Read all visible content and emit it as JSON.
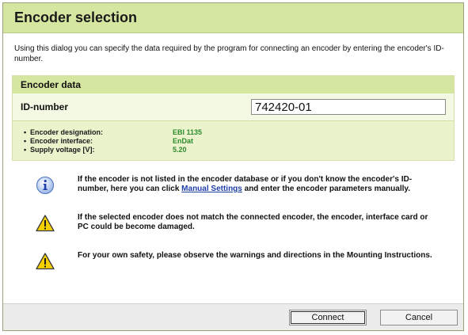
{
  "dialog": {
    "title": "Encoder selection",
    "intro": "Using this dialog you can specify the data required by the program for connecting an encoder by entering the encoder's ID-number."
  },
  "encoder_data": {
    "header": "Encoder data",
    "id_label": "ID-number",
    "id_value": "742420-01",
    "details": [
      {
        "label": "Encoder designation:",
        "value": "EBI 1135"
      },
      {
        "label": "Encoder interface:",
        "value": "EnDat"
      },
      {
        "label": "Supply voltage [V]:",
        "value": "5.20"
      }
    ]
  },
  "notes": {
    "info_before": "If the encoder is not listed in the encoder database or if you don't know the encoder's ID-number, here you can click ",
    "info_link": "Manual Settings",
    "info_after": " and enter the encoder parameters manually.",
    "warning1": "If the selected encoder does not match the connected encoder, the encoder, interface card or PC could be become damaged.",
    "warning2": "For your own safety, please observe the warnings and directions in the Mounting Instructions."
  },
  "footer": {
    "connect_label": "Connect",
    "cancel_label": "Cancel"
  },
  "icons": {
    "info": "info-icon",
    "warning": "warning-icon"
  },
  "colors": {
    "header_green": "#d5e6a0",
    "value_green": "#2e8b2e",
    "link_blue": "#1f3fa8",
    "warning_yellow": "#f5d000"
  }
}
